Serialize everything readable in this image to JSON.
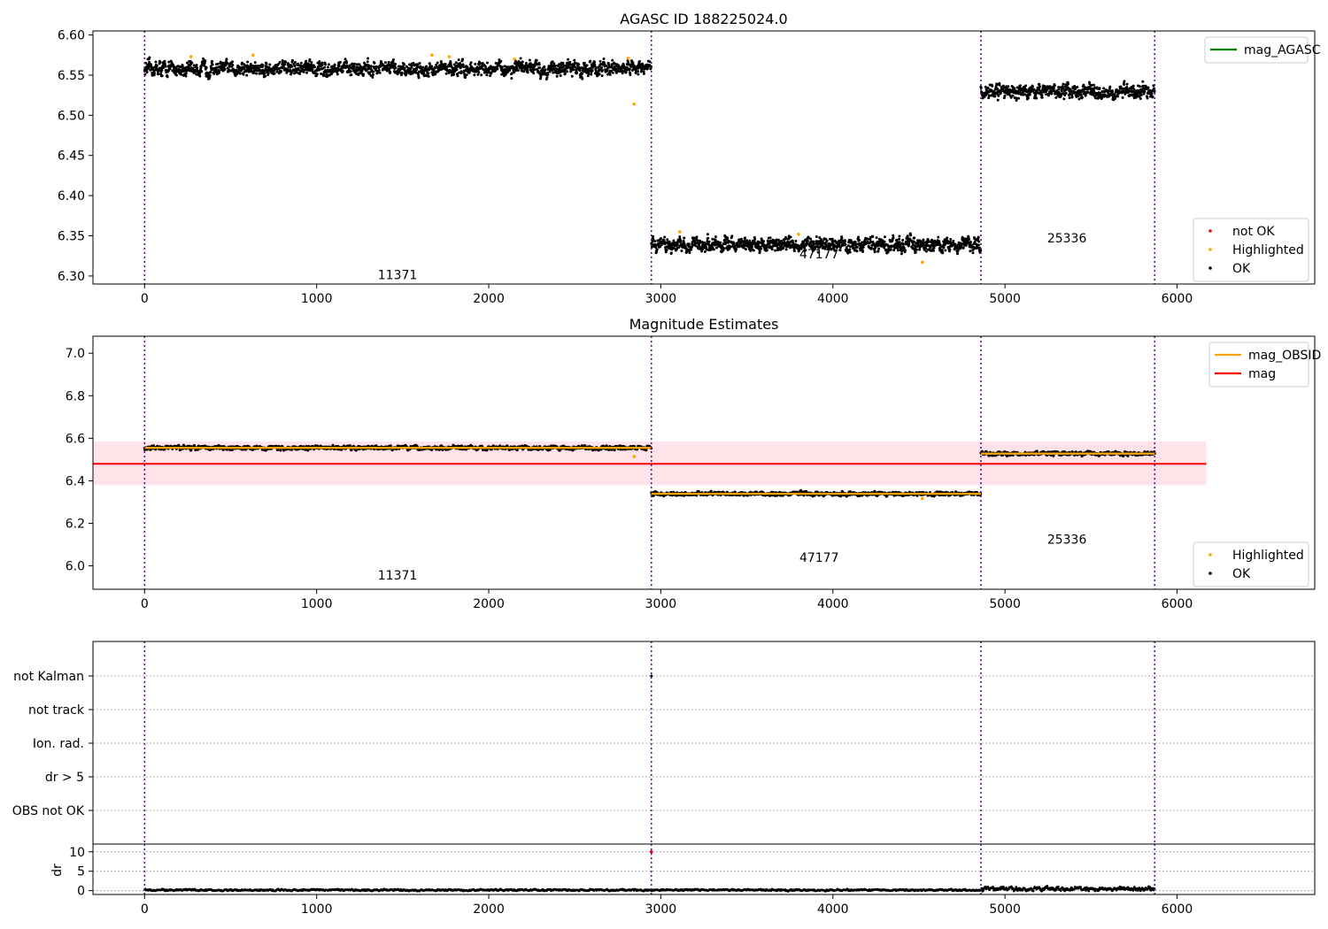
{
  "chart_data": [
    {
      "type": "scatter",
      "title": "AGASC ID 188225024.0",
      "xlabel": "",
      "ylabel": "",
      "ylim": [
        6.29,
        6.605
      ],
      "xlim": [
        -300,
        6800
      ],
      "x_ticks": [
        "0",
        "1000",
        "2000",
        "3000",
        "4000",
        "5000",
        "6000"
      ],
      "y_ticks": [
        "6.30",
        "6.35",
        "6.40",
        "6.45",
        "6.50",
        "6.55",
        "6.60"
      ],
      "obs_boundaries": [
        0,
        2945,
        4860,
        5870
      ],
      "obs_labels": [
        {
          "label": "11371",
          "x": 1470,
          "y": 6.296
        },
        {
          "label": "47177",
          "x": 3920,
          "y": 6.322
        },
        {
          "label": "25336",
          "x": 5360,
          "y": 6.342
        }
      ],
      "segments": [
        {
          "x0": 0,
          "x1": 2945,
          "mean": 6.558,
          "spread": 0.006
        },
        {
          "x0": 2945,
          "x1": 4860,
          "mean": 6.339,
          "spread": 0.006
        },
        {
          "x0": 4860,
          "x1": 5870,
          "mean": 6.53,
          "spread": 0.006
        }
      ],
      "highlighted_points": [
        {
          "x": 270,
          "y": 6.573
        },
        {
          "x": 630,
          "y": 6.575
        },
        {
          "x": 1670,
          "y": 6.575
        },
        {
          "x": 1770,
          "y": 6.573
        },
        {
          "x": 2150,
          "y": 6.57
        },
        {
          "x": 2810,
          "y": 6.571
        },
        {
          "x": 2845,
          "y": 6.514
        },
        {
          "x": 3110,
          "y": 6.355
        },
        {
          "x": 3800,
          "y": 6.352
        },
        {
          "x": 4520,
          "y": 6.317
        }
      ],
      "legend_upper": [
        {
          "name": "mag_AGASC",
          "color": "#008000"
        }
      ],
      "legend_lower": [
        {
          "name": "not OK",
          "color": "#ff0000"
        },
        {
          "name": "Highlighted",
          "color": "#ffa500"
        },
        {
          "name": "OK",
          "color": "#000000"
        }
      ],
      "legend_placement": [
        "upper right",
        "lower right"
      ]
    },
    {
      "type": "scatter",
      "title": "Magnitude Estimates",
      "xlabel": "",
      "ylabel": "",
      "ylim": [
        5.89,
        7.08
      ],
      "xlim": [
        -300,
        6800
      ],
      "x_ticks": [
        "0",
        "1000",
        "2000",
        "3000",
        "4000",
        "5000",
        "6000"
      ],
      "y_ticks": [
        "6.0",
        "6.2",
        "6.4",
        "6.6",
        "6.8",
        "7.0"
      ],
      "obs_boundaries": [
        0,
        2945,
        4860,
        5870
      ],
      "obs_labels": [
        {
          "label": "11371",
          "x": 1470,
          "y": 5.935
        },
        {
          "label": "47177",
          "x": 3920,
          "y": 6.02
        },
        {
          "label": "25336",
          "x": 5360,
          "y": 6.105
        }
      ],
      "obs_mags": [
        {
          "x0": 0,
          "x1": 2945,
          "mag": 6.555
        },
        {
          "x0": 2945,
          "x1": 4860,
          "mag": 6.339
        },
        {
          "x0": 4860,
          "x1": 5870,
          "mag": 6.528
        }
      ],
      "mag": 6.48,
      "mag_band": [
        6.38,
        6.585
      ],
      "mag_band_x": [
        -300,
        6170
      ],
      "highlighted_points": [
        {
          "x": 2845,
          "y": 6.514
        },
        {
          "x": 4520,
          "y": 6.317
        }
      ],
      "legend_upper": [
        {
          "name": "mag_OBSID",
          "color": "#ffa500"
        },
        {
          "name": "mag",
          "color": "#ff0000"
        }
      ],
      "legend_lower": [
        {
          "name": "Highlighted",
          "color": "#ffa500"
        },
        {
          "name": "OK",
          "color": "#000000"
        }
      ],
      "legend_placement": [
        "upper right",
        "lower right"
      ]
    },
    {
      "type": "scatter",
      "title": "",
      "xlabel": "",
      "ylabel": "",
      "xlim": [
        -300,
        6800
      ],
      "categories": [
        "not Kalman",
        "not track",
        "Ion. rad.",
        "dr > 5",
        "OBS not OK"
      ],
      "grid": "horizontal dotted",
      "obs_boundaries": [
        0,
        2945,
        4860,
        5870
      ],
      "flag_points": [
        {
          "x": 2945,
          "category": "not Kalman"
        }
      ]
    },
    {
      "type": "line",
      "title": "",
      "xlabel": "",
      "ylabel": "dr",
      "ylim": [
        -1,
        12
      ],
      "xlim": [
        -300,
        6800
      ],
      "x_ticks": [
        "0",
        "1000",
        "2000",
        "3000",
        "4000",
        "5000",
        "6000"
      ],
      "y_ticks": [
        "0",
        "5",
        "10"
      ],
      "obs_boundaries": [
        0,
        2945,
        4860,
        5870
      ],
      "segments": [
        {
          "x0": 0,
          "x1": 4860,
          "mean": 0.15,
          "spread": 0.15
        },
        {
          "x0": 4860,
          "x1": 5870,
          "mean": 0.45,
          "spread": 0.35
        }
      ],
      "spikes": [
        {
          "x": 2945,
          "y": 10,
          "color": "#ff0000"
        }
      ]
    }
  ]
}
